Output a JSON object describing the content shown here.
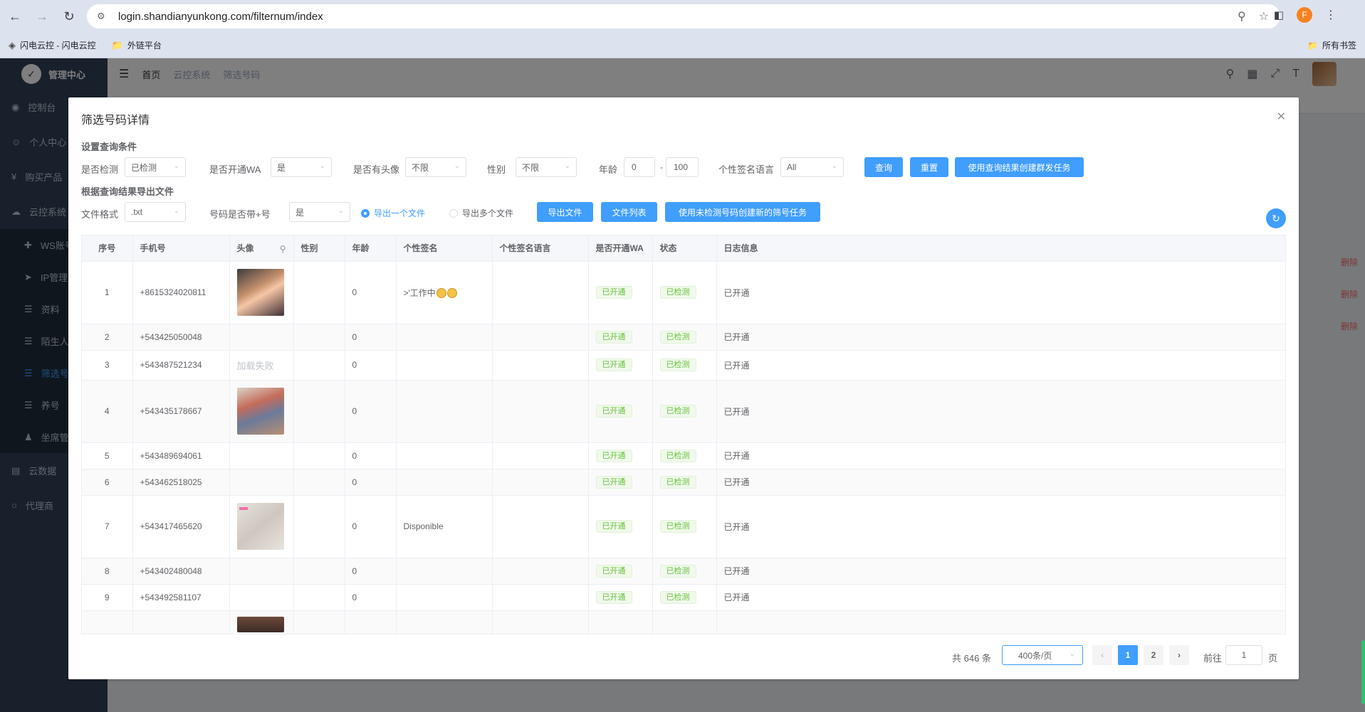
{
  "browser": {
    "url": "login.shandianyunkong.com/filternum/index",
    "profile_initial": "F",
    "bookmarks": [
      "闪电云控 - 闪电云控",
      "外链平台"
    ],
    "all_bookmarks": "所有书签"
  },
  "app": {
    "sidebar_title": "管理中心",
    "sidebar_items": [
      "控制台",
      "个人中心",
      "购买产品",
      "云控系统",
      "WS账号",
      "IP管理",
      "资料",
      "陌生人",
      "筛选号码",
      "养号",
      "坐席管理",
      "云数据",
      "代理商"
    ],
    "breadcrumb": [
      "首页",
      "云控系统",
      "筛选号码"
    ],
    "bg_row_action": "删除"
  },
  "dialog": {
    "title": "筛选号码详情",
    "query_section": "设置查询条件",
    "filters": {
      "detected_label": "是否检测",
      "detected_value": "已检测",
      "wa_label": "是否开通WA",
      "wa_value": "是",
      "avatar_label": "是否有头像",
      "avatar_value": "不限",
      "gender_label": "性别",
      "gender_value": "不限",
      "age_label": "年龄",
      "age_min": "0",
      "age_max": "100",
      "age_sep": "-",
      "lang_label": "个性签名语言",
      "lang_value": "All"
    },
    "buttons": {
      "query": "查询",
      "reset": "重置",
      "create_group_task": "使用查询结果创建群发任务",
      "export_file": "导出文件",
      "file_list": "文件列表",
      "create_filter_task": "使用未检测号码创建新的筛号任务"
    },
    "export_section": "根据查询结果导出文件",
    "export": {
      "format_label": "文件格式",
      "format_value": ".txt",
      "plus_label": "号码是否带+号",
      "plus_value": "是",
      "radio_single": "导出一个文件",
      "radio_multi": "导出多个文件",
      "selected": "single"
    },
    "table": {
      "columns": [
        "序号",
        "手机号",
        "头像",
        "性别",
        "年龄",
        "个性签名",
        "个性签名语言",
        "是否开通WA",
        "状态",
        "日志信息"
      ],
      "rows": [
        {
          "index": "1",
          "phone": "+8615324020811",
          "avatar": "photo-a",
          "gender": "",
          "age": "0",
          "signature": ">'工作中",
          "sig_emoji": 2,
          "lang": "",
          "wa": "已开通",
          "status": "已检测",
          "log": "已开通"
        },
        {
          "index": "2",
          "phone": "+543425050048",
          "avatar": "",
          "gender": "",
          "age": "0",
          "signature": "",
          "sig_emoji": 0,
          "lang": "",
          "wa": "已开通",
          "status": "已检测",
          "log": "已开通"
        },
        {
          "index": "3",
          "phone": "+543487521234",
          "avatar": "failed",
          "avatar_text": "加载失败",
          "gender": "",
          "age": "0",
          "signature": "",
          "sig_emoji": 0,
          "lang": "",
          "wa": "已开通",
          "status": "已检测",
          "log": "已开通"
        },
        {
          "index": "4",
          "phone": "+543435178667",
          "avatar": "photo-b",
          "gender": "",
          "age": "0",
          "signature": "",
          "sig_emoji": 0,
          "lang": "",
          "wa": "已开通",
          "status": "已检测",
          "log": "已开通"
        },
        {
          "index": "5",
          "phone": "+543489694061",
          "avatar": "",
          "gender": "",
          "age": "0",
          "signature": "",
          "sig_emoji": 0,
          "lang": "",
          "wa": "已开通",
          "status": "已检测",
          "log": "已开通"
        },
        {
          "index": "6",
          "phone": "+543462518025",
          "avatar": "",
          "gender": "",
          "age": "0",
          "signature": "",
          "sig_emoji": 0,
          "lang": "",
          "wa": "已开通",
          "status": "已检测",
          "log": "已开通"
        },
        {
          "index": "7",
          "phone": "+543417465620",
          "avatar": "photo-c",
          "gender": "",
          "age": "0",
          "signature": "Disponible",
          "sig_emoji": 0,
          "lang": "",
          "wa": "已开通",
          "status": "已检测",
          "log": "已开通"
        },
        {
          "index": "8",
          "phone": "+543402480048",
          "avatar": "",
          "gender": "",
          "age": "0",
          "signature": "",
          "sig_emoji": 0,
          "lang": "",
          "wa": "已开通",
          "status": "已检测",
          "log": "已开通"
        },
        {
          "index": "9",
          "phone": "+543492581107",
          "avatar": "",
          "gender": "",
          "age": "0",
          "signature": "",
          "sig_emoji": 0,
          "lang": "",
          "wa": "已开通",
          "status": "已检测",
          "log": "已开通"
        },
        {
          "index": "",
          "phone": "",
          "avatar": "photo-d",
          "gender": "",
          "age": "",
          "signature": "",
          "sig_emoji": 0,
          "lang": "",
          "wa": "",
          "status": "",
          "log": ""
        }
      ]
    },
    "pagination": {
      "total": "共 646 条",
      "page_size": "400条/页",
      "pages": [
        "1",
        "2"
      ],
      "current": "1",
      "goto_label": "前往",
      "goto_value": "1",
      "unit": "页"
    }
  }
}
